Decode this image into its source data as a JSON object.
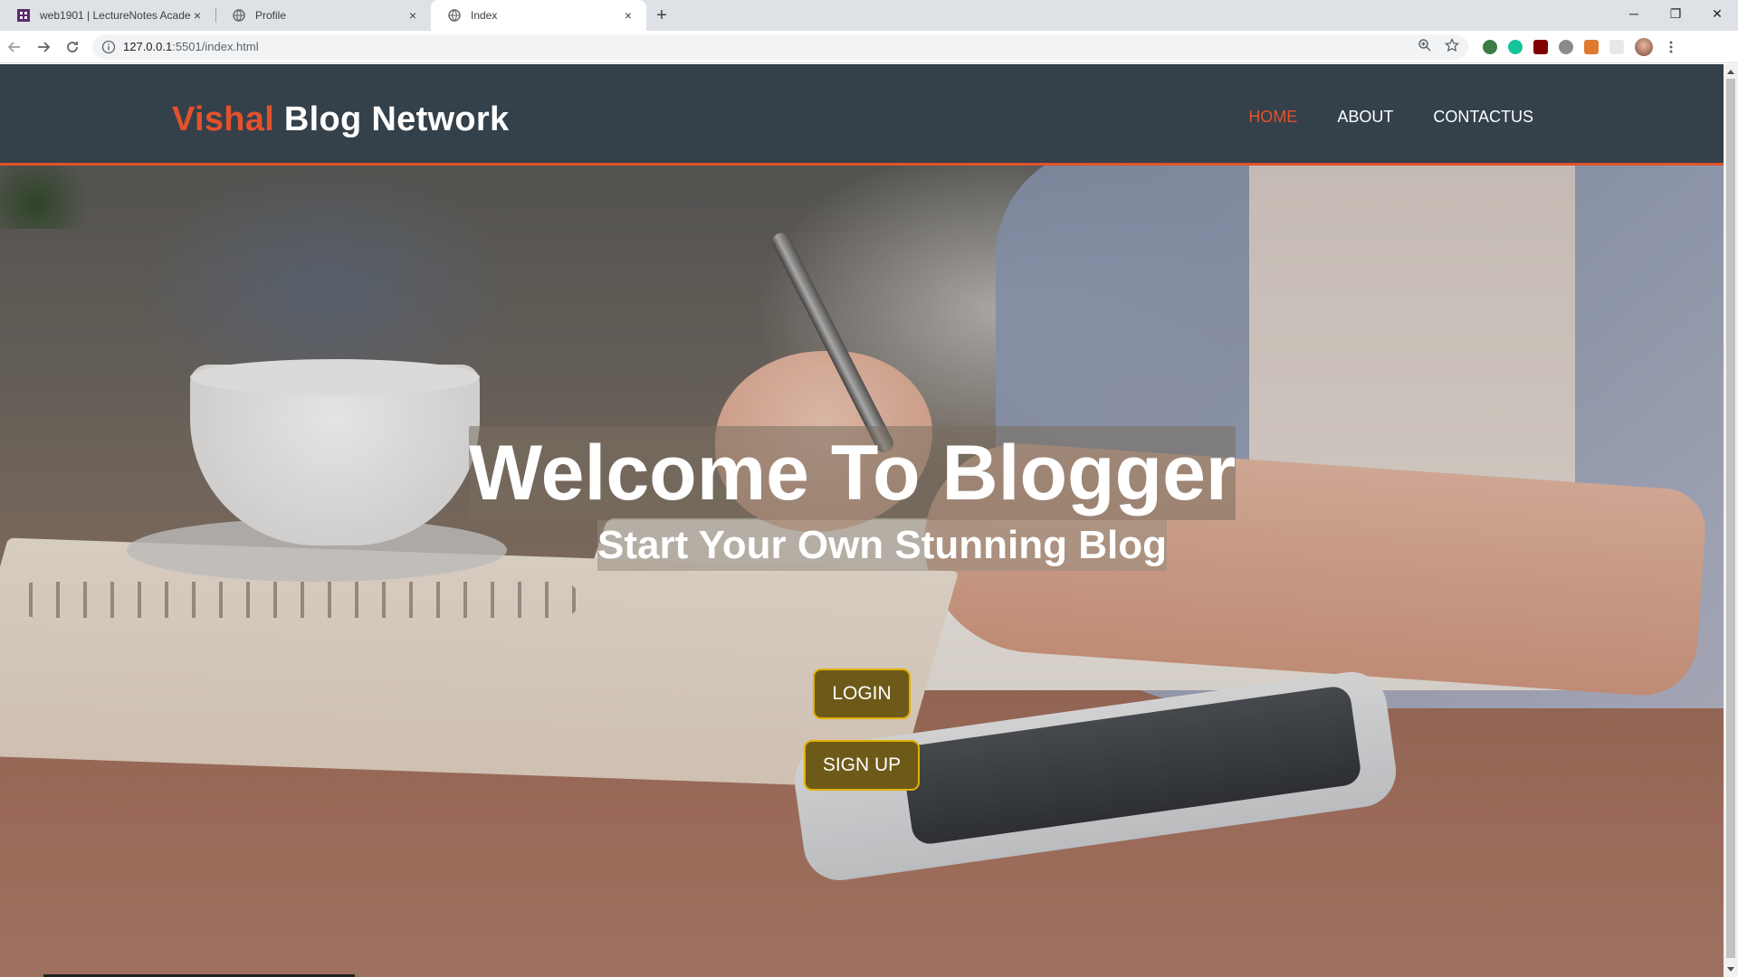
{
  "browser": {
    "tabs": [
      {
        "title": "web1901 | LectureNotes Academ",
        "close": "×",
        "active": false,
        "favicon": "lecturenotes-icon"
      },
      {
        "title": "Profile",
        "close": "×",
        "active": false,
        "favicon": "globe-icon"
      },
      {
        "title": "Index",
        "close": "×",
        "active": true,
        "favicon": "globe-icon"
      }
    ],
    "new_tab": "+",
    "window_controls": {
      "minimize": "─",
      "restore": "❐",
      "close": "✕"
    },
    "url_host": "127.0.0.1",
    "url_rest": ":5501/index.html"
  },
  "site": {
    "brand_accent": "Vishal",
    "brand_rest": " Blog Network",
    "nav": [
      {
        "label": "HOME",
        "active": true
      },
      {
        "label": "ABOUT",
        "active": false
      },
      {
        "label": "CONTACTUS",
        "active": false
      }
    ]
  },
  "hero": {
    "title": "Welcome To Blogger",
    "subtitle": "Start Your Own Stunning Blog",
    "login_label": "LOGIN",
    "signup_label": "SIGN UP"
  },
  "colors": {
    "header_bg": "#34404a",
    "accent": "#e2522d",
    "button_bg": "#6e5a18",
    "button_border": "#e2b100"
  }
}
